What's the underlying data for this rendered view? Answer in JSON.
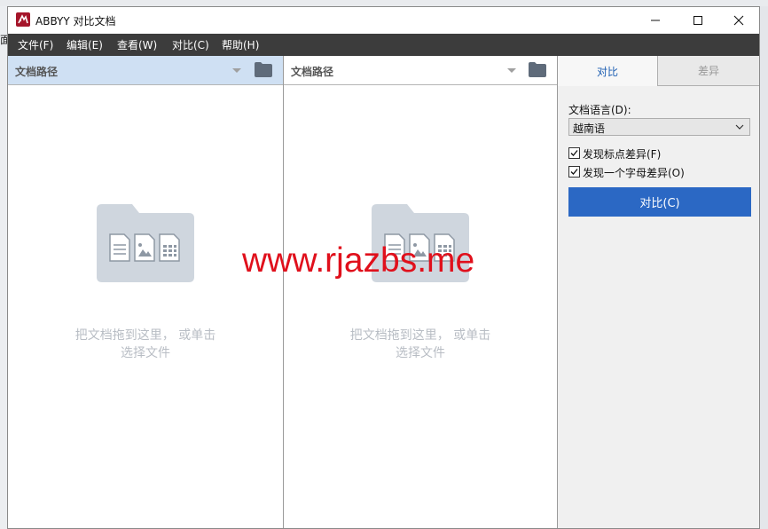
{
  "background_app": {
    "side_label": "面"
  },
  "window": {
    "title": "ABBYY 对比文档",
    "controls": {
      "minimize": "—",
      "maximize": "☐",
      "close": "✕"
    }
  },
  "menu": [
    {
      "label": "文件(F)"
    },
    {
      "label": "编辑(E)"
    },
    {
      "label": "查看(W)"
    },
    {
      "label": "对比(C)"
    },
    {
      "label": "帮助(H)"
    }
  ],
  "panels": [
    {
      "path_label": "文档路径",
      "drop_hint_line1": "把文档拖到这里，  或单击",
      "drop_hint_line2": "选择文件"
    },
    {
      "path_label": "文档路径",
      "drop_hint_line1": "把文档拖到这里，  或单击",
      "drop_hint_line2": "选择文件"
    }
  ],
  "side_panel": {
    "tabs": [
      {
        "label": "对比"
      },
      {
        "label": "差异"
      }
    ],
    "language_label": "文档语言(D):",
    "language_value": "越南语",
    "options": [
      {
        "label": "发现标点差异(F)",
        "checked": true
      },
      {
        "label": "发现一个字母差异(O)",
        "checked": true
      }
    ],
    "compare_button": "对比(C)"
  },
  "watermark": "www.rjazbs.me",
  "colors": {
    "menubar": "#3c3c3c",
    "selected_path_bar": "#cfe0f3",
    "accent_button": "#2b68c4",
    "tab_active_text": "#1e5fb3",
    "watermark": "#e0101c",
    "folder_icon": "#cfd6de",
    "app_icon": "#a5152a"
  },
  "icons": {
    "app": "abbyy-logo-icon",
    "folder": "folder-icon",
    "dropdown": "chevron-down-icon",
    "checkbox": "checkmark-icon",
    "documents": "documents-folder-icon"
  }
}
